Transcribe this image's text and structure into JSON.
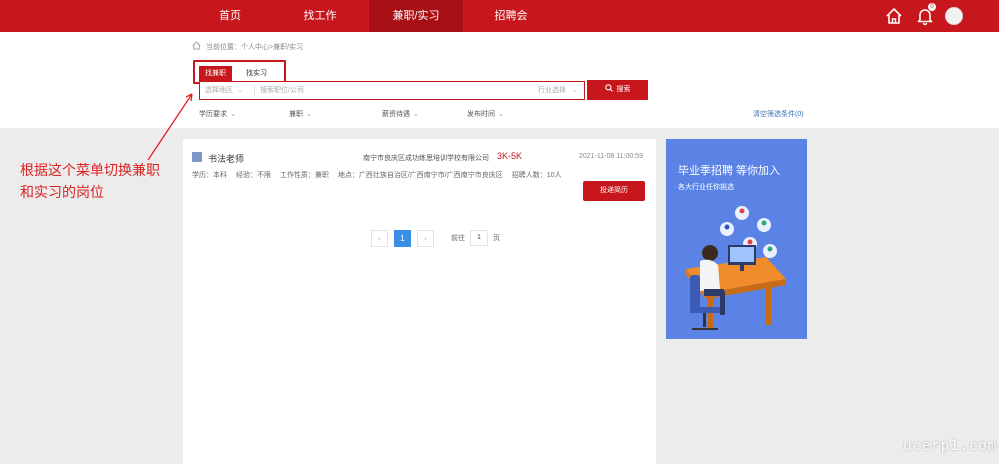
{
  "nav": {
    "items": [
      {
        "label": "首页"
      },
      {
        "label": "找工作"
      },
      {
        "label": "兼职/实习"
      },
      {
        "label": "招聘会"
      }
    ],
    "active_index": 2,
    "bell_badge": "0"
  },
  "breadcrumb": "当前位置：个人中心>兼职/实习",
  "tabs": [
    {
      "label": "找兼职",
      "active": true
    },
    {
      "label": "找实习",
      "active": false
    }
  ],
  "search": {
    "area_label": "选择地区",
    "placeholder": "搜索职位/公司",
    "industry_label": "行业选择",
    "button_label": "搜索"
  },
  "filters": [
    {
      "label": "学历要求"
    },
    {
      "label": "兼职"
    },
    {
      "label": "薪资待遇"
    },
    {
      "label": "发布时间"
    }
  ],
  "clear_filters": "清空筛选条件(0)",
  "job": {
    "title": "书法老师",
    "company": "南宁市良庆区成功练思培训学校有限公司",
    "salary": "3K-5K",
    "published": "2021-11-08 11:00:59",
    "meta": {
      "education": "学历：本科",
      "experience": "经验：不限",
      "nature": "工作性质：兼职",
      "location": "地点：广西壮族自治区/广西南宁市/广西南宁市良庆区",
      "headcount": "招聘人数：10人"
    },
    "apply_label": "投递简历"
  },
  "pagination": {
    "prev": "‹",
    "current": "1",
    "next": "›",
    "goto_prefix": "前往",
    "goto_value": "1",
    "goto_suffix": "页"
  },
  "annotation": "根据这个菜单切换兼职和实习的岗位",
  "ad": {
    "title": "毕业季招聘 等你加入",
    "subtitle": "各大行业任你挑选"
  },
  "watermark": "ucerp1.com",
  "colors": {
    "brand_red": "#c8161d",
    "ad_blue": "#5b83e6",
    "page_active": "#3a8ee6",
    "link_blue": "#3b6fb6"
  }
}
